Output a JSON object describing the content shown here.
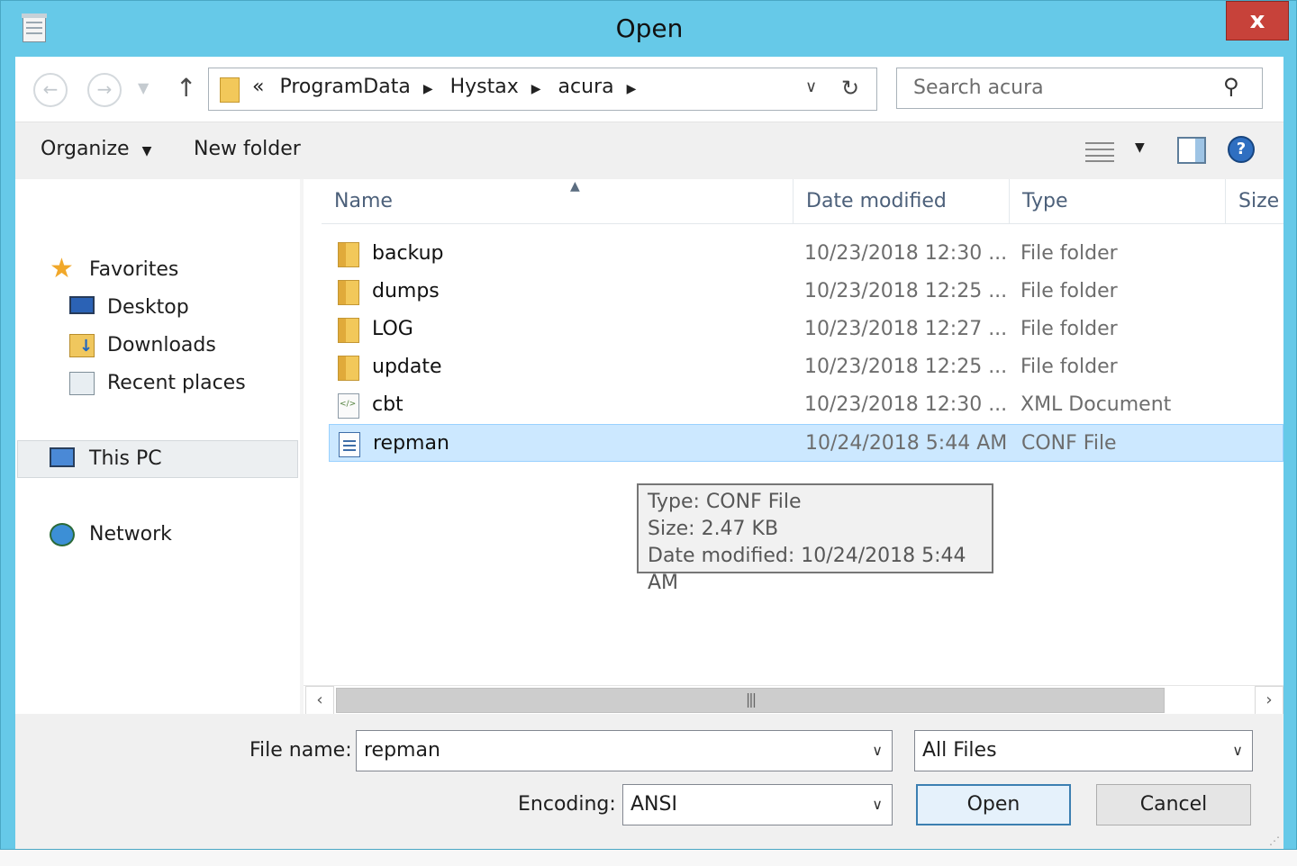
{
  "window": {
    "title": "Open",
    "close_label": "x"
  },
  "address": {
    "overflow": "«",
    "crumbs": [
      "ProgramData",
      "Hystax",
      "acura"
    ],
    "search_placeholder": "Search acura"
  },
  "toolbar": {
    "organize": "Organize",
    "new_folder": "New folder"
  },
  "nav": {
    "favorites": "Favorites",
    "desktop": "Desktop",
    "downloads": "Downloads",
    "recent": "Recent places",
    "this_pc": "This PC",
    "network": "Network"
  },
  "columns": {
    "name": "Name",
    "date": "Date modified",
    "type": "Type",
    "size": "Size"
  },
  "files": [
    {
      "name": "backup",
      "date": "10/23/2018 12:30 ...",
      "type": "File folder",
      "icon": "folder-icon"
    },
    {
      "name": "dumps",
      "date": "10/23/2018 12:25 ...",
      "type": "File folder",
      "icon": "folder-icon"
    },
    {
      "name": "LOG",
      "date": "10/23/2018 12:27 ...",
      "type": "File folder",
      "icon": "folder-icon"
    },
    {
      "name": "update",
      "date": "10/23/2018 12:25 ...",
      "type": "File folder",
      "icon": "folder-icon"
    },
    {
      "name": "cbt",
      "date": "10/23/2018 12:30 ...",
      "type": "XML Document",
      "icon": "xml-file-icon"
    },
    {
      "name": "repman",
      "date": "10/24/2018 5:44 AM",
      "type": "CONF File",
      "icon": "conf-file-icon",
      "selected": true
    }
  ],
  "tooltip": {
    "type": "Type: CONF File",
    "size": "Size: 2.47 KB",
    "date": "Date modified: 10/24/2018 5:44 AM"
  },
  "bottom": {
    "file_name_label": "File name:",
    "file_name_value": "repman",
    "filter_value": "All Files",
    "encoding_label": "Encoding:",
    "encoding_value": "ANSI",
    "open_label": "Open",
    "cancel_label": "Cancel"
  },
  "colors": {
    "titlebar": "#66c9e8",
    "close": "#c7423a",
    "selection": "#cce8ff"
  }
}
